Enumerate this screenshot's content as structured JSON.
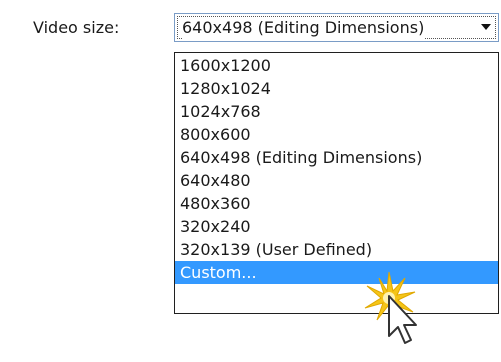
{
  "video_size": {
    "label": "Video size:",
    "selected_value": "640x498 (Editing Dimensions)",
    "options": [
      "1600x1200",
      "1280x1024",
      "1024x768",
      "800x600",
      "640x498 (Editing Dimensions)",
      "640x480",
      "480x360",
      "320x240",
      "320x139 (User Defined)",
      "Custom..."
    ],
    "highlighted_option": "Custom..."
  },
  "icons": {
    "dropdown_arrow": "chevron-down-icon",
    "click_burst": "click-highlight-icon",
    "pointer": "mouse-pointer-icon"
  },
  "colors": {
    "highlight": "#3399ff",
    "combo_border": "#7a9cc6",
    "click_burst": "#f5c518"
  }
}
